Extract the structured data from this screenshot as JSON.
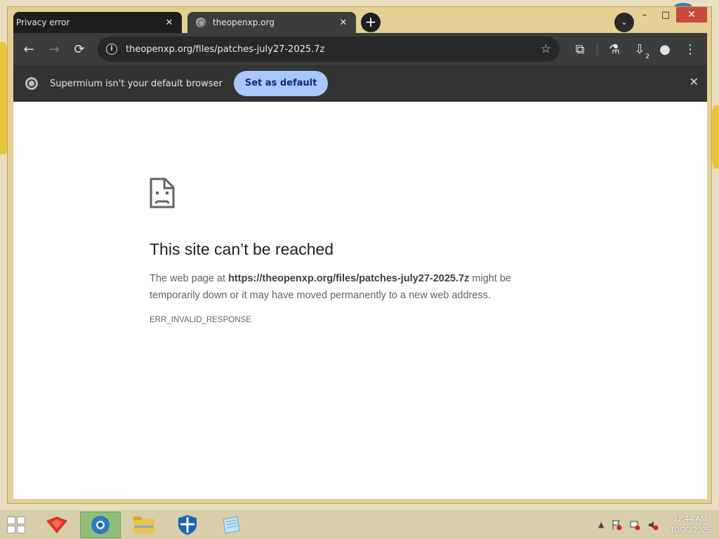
{
  "tabs": [
    {
      "title": "Privacy error",
      "close": "✕"
    },
    {
      "title": "theopenxp.org",
      "close": "✕"
    }
  ],
  "newtab_label": "+",
  "tab_search_label": "⌄",
  "window_controls": {
    "minimize": "–",
    "maximize": "□",
    "close": "✕"
  },
  "toolbar": {
    "back": "←",
    "forward": "→",
    "reload": "⟳",
    "url": "theopenxp.org/files/patches-july27-2025.7z",
    "star": "☆",
    "extensions": "⧉",
    "labs": "⚗",
    "downloads_count": "2",
    "downloads": "⇩",
    "profile": "●",
    "menu": "⋮"
  },
  "infobar": {
    "message": "Supermium isn't your default browser",
    "button": "Set as default",
    "close": "✕"
  },
  "error": {
    "title": "This site can’t be reached",
    "body_pre": "The web page at ",
    "body_url": "https://theopenxp.org/files/patches-july27-2025.7z",
    "body_post": " might be temporarily down or it may have moved permanently to a new web address.",
    "code": "ERR_INVALID_RESPONSE"
  },
  "taskbar": {
    "time": "12:44 AM",
    "date": "10/30/2025",
    "tray_arrow": "▲"
  },
  "colors": {
    "infobar_button": "#a8c7fa",
    "toolbar": "#3c3c3c",
    "close_button": "#c94a3c"
  }
}
